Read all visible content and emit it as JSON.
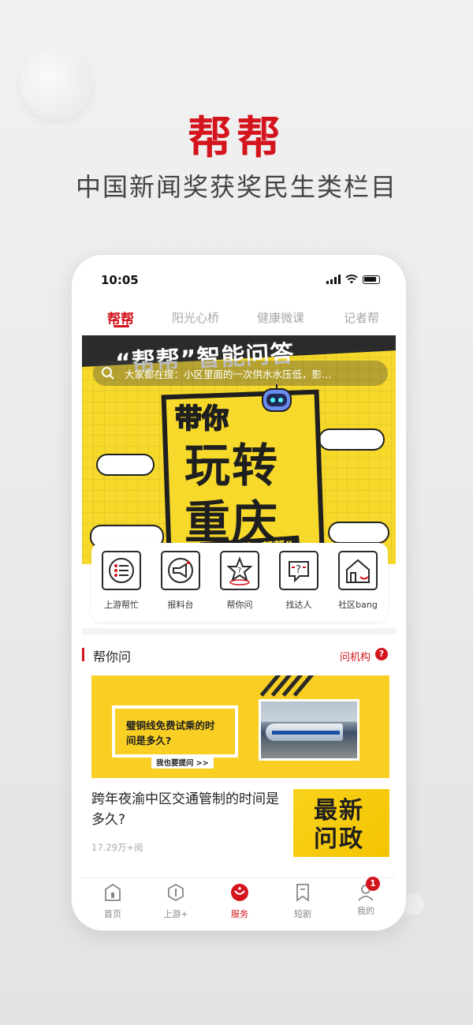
{
  "promo": {
    "title": "帮帮",
    "subtitle": "中国新闻奖获奖民生类栏目"
  },
  "status_bar": {
    "time": "10:05"
  },
  "tabs": [
    "帮帮",
    "阳光心桥",
    "健康微课",
    "记者帮"
  ],
  "hero": {
    "title": "“帮帮”智能问答",
    "search_placeholder": "大家都在搜：小区里面的一次供水水压低，影…",
    "line1": "带你",
    "line2": "玩转",
    "line3": "重庆",
    "slogan": "问题，找“帮帮”"
  },
  "services": [
    {
      "label": "上游帮忙",
      "icon": "list-icon"
    },
    {
      "label": "报料台",
      "icon": "megaphone-icon"
    },
    {
      "label": "帮你问",
      "icon": "question-star-icon"
    },
    {
      "label": "找达人",
      "icon": "chat-question-icon"
    },
    {
      "label": "社区bang",
      "icon": "community-house-icon"
    }
  ],
  "section": {
    "title": "帮你问",
    "link": "问机构",
    "help_icon": "?"
  },
  "banner": {
    "question": "璧铜线免费试乘的时间是多久?",
    "button": "我也要提问 >>"
  },
  "news": [
    {
      "title": "跨年夜渝中区交通管制的时间是多久?",
      "meta": "17.29万+阅",
      "thumb_text": "最新问政"
    }
  ],
  "bottom_nav": [
    {
      "label": "首页",
      "icon": "home-icon"
    },
    {
      "label": "上游+",
      "icon": "hexagon-icon"
    },
    {
      "label": "服务",
      "icon": "service-icon",
      "active": true
    },
    {
      "label": "短剧",
      "icon": "bookmark-icon"
    },
    {
      "label": "我的",
      "icon": "user-icon",
      "badge": "1"
    }
  ],
  "colors": {
    "brand_red": "#d4141d",
    "hero_yellow": "#f6d92b"
  }
}
